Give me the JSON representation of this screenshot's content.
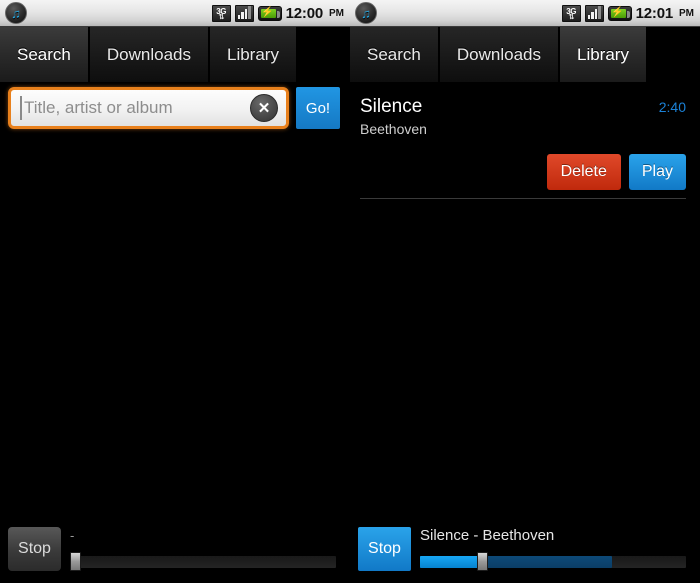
{
  "left": {
    "status": {
      "notification_icon": "music-note-icon",
      "network_label": "3G",
      "network_arrows": "⇅",
      "signal_icon": "signal-bars-icon",
      "battery_icon": "battery-charging-icon",
      "time": "12:00",
      "ampm": "PM"
    },
    "tabs": [
      {
        "label": "Search",
        "selected": true
      },
      {
        "label": "Downloads",
        "selected": false
      },
      {
        "label": "Library",
        "selected": false
      }
    ],
    "search": {
      "value": "",
      "placeholder": "Title, artist or album",
      "clear_icon": "✕",
      "go_label": "Go!"
    },
    "player": {
      "stop_label": "Stop",
      "now_playing": "-",
      "progress_percent": 0,
      "secondary_percent": 0
    }
  },
  "right": {
    "status": {
      "notification_icon": "music-note-icon",
      "network_label": "3G",
      "network_arrows": "⇅",
      "signal_icon": "signal-bars-icon",
      "battery_icon": "battery-charging-icon",
      "time": "12:01",
      "ampm": "PM"
    },
    "tabs": [
      {
        "label": "Search",
        "selected": false
      },
      {
        "label": "Downloads",
        "selected": false
      },
      {
        "label": "Library",
        "selected": true
      }
    ],
    "library": {
      "items": [
        {
          "title": "Silence",
          "artist": "Beethoven",
          "duration": "2:40",
          "delete_label": "Delete",
          "play_label": "Play"
        }
      ]
    },
    "player": {
      "stop_label": "Stop",
      "now_playing": "Silence - Beethoven",
      "progress_percent": 22,
      "secondary_percent": 72
    }
  },
  "colors": {
    "accent_blue": "#1579c4",
    "delete_red": "#c0290c",
    "focus_orange": "#e8801c",
    "duration_blue": "#1b81d6"
  }
}
